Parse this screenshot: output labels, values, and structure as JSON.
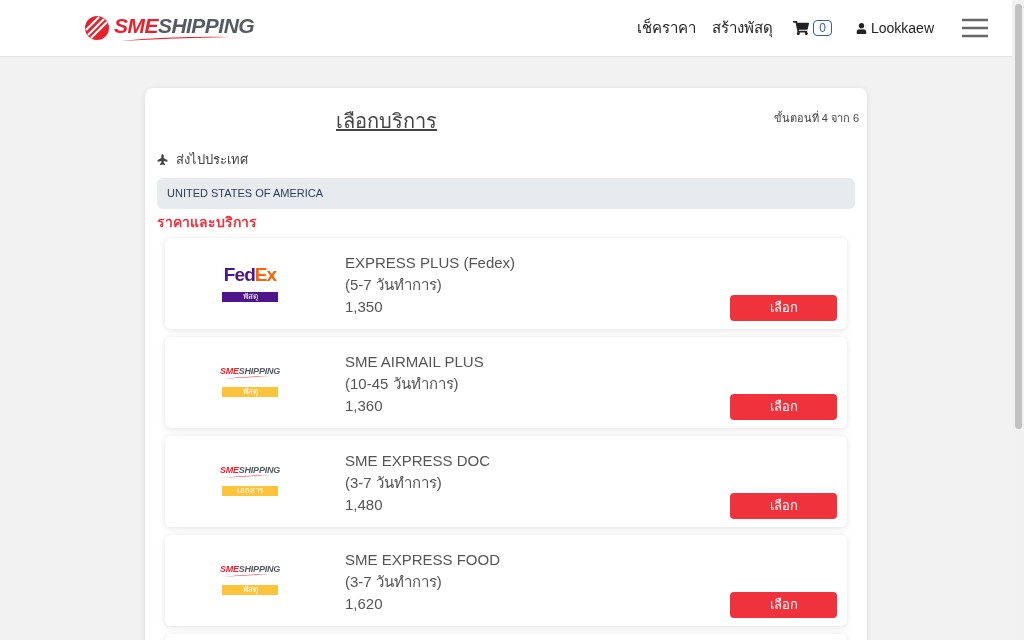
{
  "header": {
    "logo": {
      "red": "SME",
      "dark": "SHIPPING"
    },
    "nav": [
      "เช็คราคา",
      "สร้างพัสดุ"
    ],
    "cart_count": "0",
    "user": "Lookkaew"
  },
  "panel": {
    "title": "เลือกบริการ",
    "step": "ขั้นตอนที่ 4 จาก 6",
    "destination_label": "ส่งไปประเทศ",
    "destination": "UNITED STATES OF AMERICA",
    "section": "ราคาและบริการ"
  },
  "services": [
    {
      "kind": "fedex",
      "logo": [
        "Fed",
        "Ex"
      ],
      "tag": "พัสดุ",
      "name": "EXPRESS PLUS (Fedex)",
      "duration": "(5-7 วันทำการ)",
      "price": "1,350",
      "button": "เลือก"
    },
    {
      "kind": "sme",
      "logo": [
        "SME",
        "SHIPPING"
      ],
      "tag": "พัสดุ",
      "name": "SME AIRMAIL PLUS",
      "duration": "(10-45 วันทำการ)",
      "price": "1,360",
      "button": "เลือก"
    },
    {
      "kind": "sme",
      "logo": [
        "SME",
        "SHIPPING"
      ],
      "tag": "เอกสาร",
      "name": "SME EXPRESS DOC",
      "duration": "(3-7 วันทำการ)",
      "price": "1,480",
      "button": "เลือก"
    },
    {
      "kind": "sme",
      "logo": [
        "SME",
        "SHIPPING"
      ],
      "tag": "พัสดุ",
      "name": "SME EXPRESS FOOD",
      "duration": "(3-7 วันทำการ)",
      "price": "1,620",
      "button": "เลือก"
    }
  ]
}
